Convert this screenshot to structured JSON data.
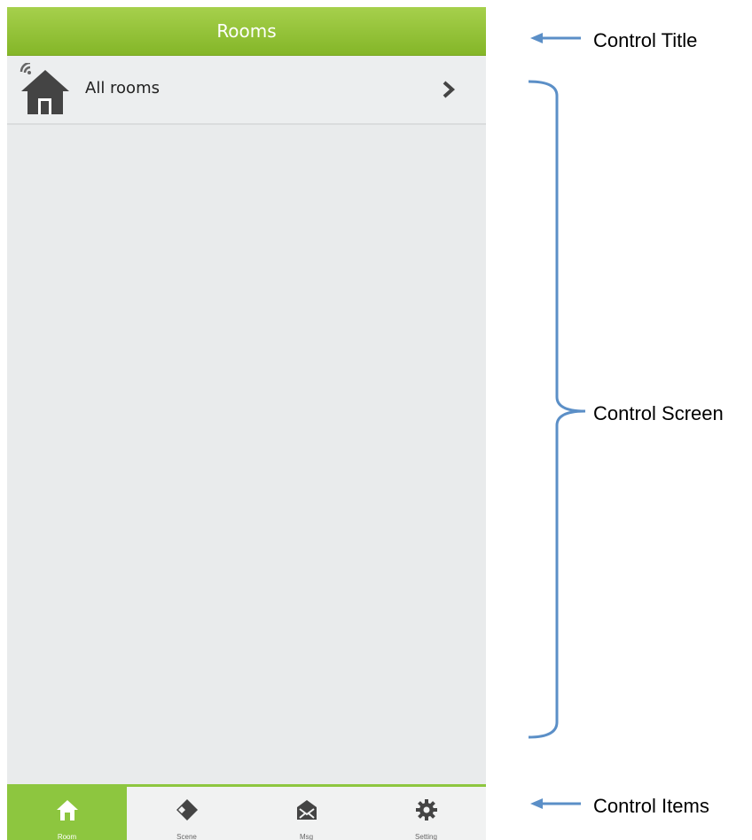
{
  "header": {
    "title": "Rooms"
  },
  "rooms": [
    {
      "label": "All rooms"
    }
  ],
  "tabs": [
    {
      "label": "Room",
      "icon": "home-icon",
      "active": true
    },
    {
      "label": "Scene",
      "icon": "scene-icon",
      "active": false
    },
    {
      "label": "Msg",
      "icon": "message-icon",
      "active": false
    },
    {
      "label": "Setting",
      "icon": "gear-icon",
      "active": false
    }
  ],
  "annotations": {
    "title": "Control Title",
    "screen": "Control Screen",
    "items": "Control Items"
  },
  "colors": {
    "accent": "#8dc63f",
    "annotation_line": "#5b8fc7"
  }
}
